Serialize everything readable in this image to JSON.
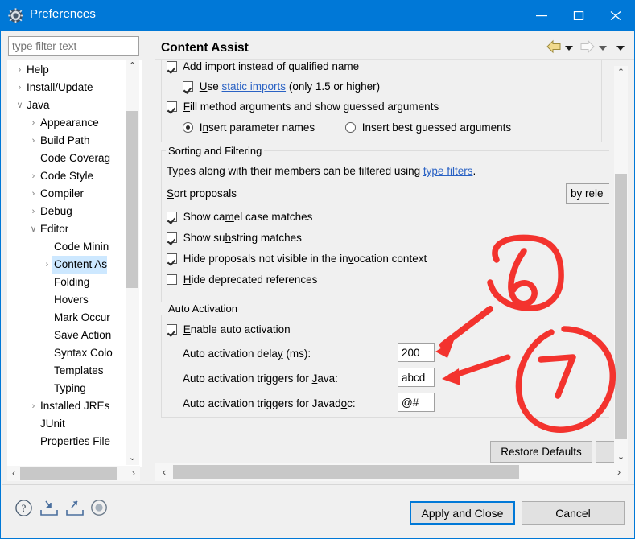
{
  "window": {
    "title": "Preferences",
    "title_icon": "gear-icon",
    "titlebar_color": "#0078d7",
    "minimize_label": "Minimize",
    "maximize_label": "Maximize",
    "close_label": "Close"
  },
  "filter": {
    "placeholder": "type filter text",
    "value": ""
  },
  "tree": {
    "items": [
      {
        "label": "Help",
        "indent": 0,
        "arrow": "collapsed",
        "selected": false
      },
      {
        "label": "Install/Update",
        "indent": 0,
        "arrow": "collapsed",
        "selected": false
      },
      {
        "label": "Java",
        "indent": 0,
        "arrow": "expanded",
        "selected": false
      },
      {
        "label": "Appearance",
        "indent": 1,
        "arrow": "collapsed",
        "selected": false
      },
      {
        "label": "Build Path",
        "indent": 1,
        "arrow": "collapsed",
        "selected": false
      },
      {
        "label": "Code Coverag",
        "indent": 1,
        "arrow": "none",
        "selected": false
      },
      {
        "label": "Code Style",
        "indent": 1,
        "arrow": "collapsed",
        "selected": false
      },
      {
        "label": "Compiler",
        "indent": 1,
        "arrow": "collapsed",
        "selected": false
      },
      {
        "label": "Debug",
        "indent": 1,
        "arrow": "collapsed",
        "selected": false
      },
      {
        "label": "Editor",
        "indent": 1,
        "arrow": "expanded",
        "selected": false
      },
      {
        "label": "Code Minin",
        "indent": 2,
        "arrow": "none",
        "selected": false
      },
      {
        "label": "Content As",
        "indent": 2,
        "arrow": "collapsed",
        "selected": true
      },
      {
        "label": "Folding",
        "indent": 2,
        "arrow": "none",
        "selected": false
      },
      {
        "label": "Hovers",
        "indent": 2,
        "arrow": "none",
        "selected": false
      },
      {
        "label": "Mark Occur",
        "indent": 2,
        "arrow": "none",
        "selected": false
      },
      {
        "label": "Save Action",
        "indent": 2,
        "arrow": "none",
        "selected": false
      },
      {
        "label": "Syntax Colo",
        "indent": 2,
        "arrow": "none",
        "selected": false
      },
      {
        "label": "Templates",
        "indent": 2,
        "arrow": "none",
        "selected": false
      },
      {
        "label": "Typing",
        "indent": 2,
        "arrow": "none",
        "selected": false
      },
      {
        "label": "Installed JREs",
        "indent": 1,
        "arrow": "collapsed",
        "selected": false
      },
      {
        "label": "JUnit",
        "indent": 1,
        "arrow": "none",
        "selected": false
      },
      {
        "label": "Properties File",
        "indent": 1,
        "arrow": "none",
        "selected": false
      }
    ]
  },
  "page": {
    "title": "Content Assist",
    "nav": {
      "back_icon": "arrow-left-icon",
      "back_menu_icon": "chevron-down-icon",
      "forward_icon": "arrow-right-icon",
      "forward_menu_icon": "chevron-down-icon",
      "view_menu_icon": "chevron-down-icon"
    }
  },
  "insertion": {
    "add_import": {
      "label": "Add import instead of qualified name",
      "checked": true,
      "clipped": true
    },
    "use_static_imports": {
      "prefix": "Use ",
      "link": "static imports",
      "suffix": " (only 1.5 or higher)",
      "checked": true
    },
    "fill_method_arguments": {
      "label": "Fill method arguments and show guessed arguments",
      "checked": true
    },
    "radio_insert_parameter_names": {
      "label": "Insert parameter names",
      "selected": true
    },
    "radio_insert_best_guessed": {
      "label": "Insert best guessed arguments",
      "selected": false
    }
  },
  "sorting_filtering": {
    "group_title": "Sorting and Filtering",
    "description_prefix": "Types along with their members can be filtered using ",
    "description_link": "type filters",
    "description_suffix": ".",
    "sort_proposals_label": "Sort proposals",
    "sort_proposals_value": "by rele",
    "checkboxes": [
      {
        "label": "Show camel case matches",
        "checked": true
      },
      {
        "label": "Show substring matches",
        "checked": true
      },
      {
        "label": "Hide proposals not visible in the invocation context",
        "checked": true
      },
      {
        "label": "Hide deprecated references",
        "checked": false
      }
    ]
  },
  "auto_activation": {
    "group_title": "Auto Activation",
    "enable": {
      "label": "Enable auto activation",
      "checked": true
    },
    "fields": [
      {
        "label": "Auto activation delay (ms):",
        "value": "200"
      },
      {
        "label": "Auto activation triggers for Java:",
        "value": "abcd"
      },
      {
        "label": "Auto activation triggers for Javadoc:",
        "value": "@#"
      }
    ]
  },
  "buttons": {
    "restore_defaults": "Restore Defaults",
    "apply_and_close": "Apply and Close",
    "cancel": "Cancel"
  },
  "bottom_icons": [
    {
      "name": "help-icon"
    },
    {
      "name": "import-icon"
    },
    {
      "name": "export-icon"
    },
    {
      "name": "record-icon"
    }
  ],
  "scrollbars": {
    "tree_up": "⌃",
    "tree_down": "⌄",
    "tree_left": "‹",
    "tree_right": "›",
    "main_up": "⌃",
    "main_down": "⌄",
    "main_left": "‹",
    "main_right": "›"
  },
  "annotations": {
    "color": "#f3332e",
    "marks": [
      {
        "name": "circled-six",
        "text": "6"
      },
      {
        "name": "circled-seven",
        "text": "7"
      },
      {
        "name": "arrow-to-delay-field"
      },
      {
        "name": "arrow-to-java-triggers-field"
      }
    ]
  }
}
